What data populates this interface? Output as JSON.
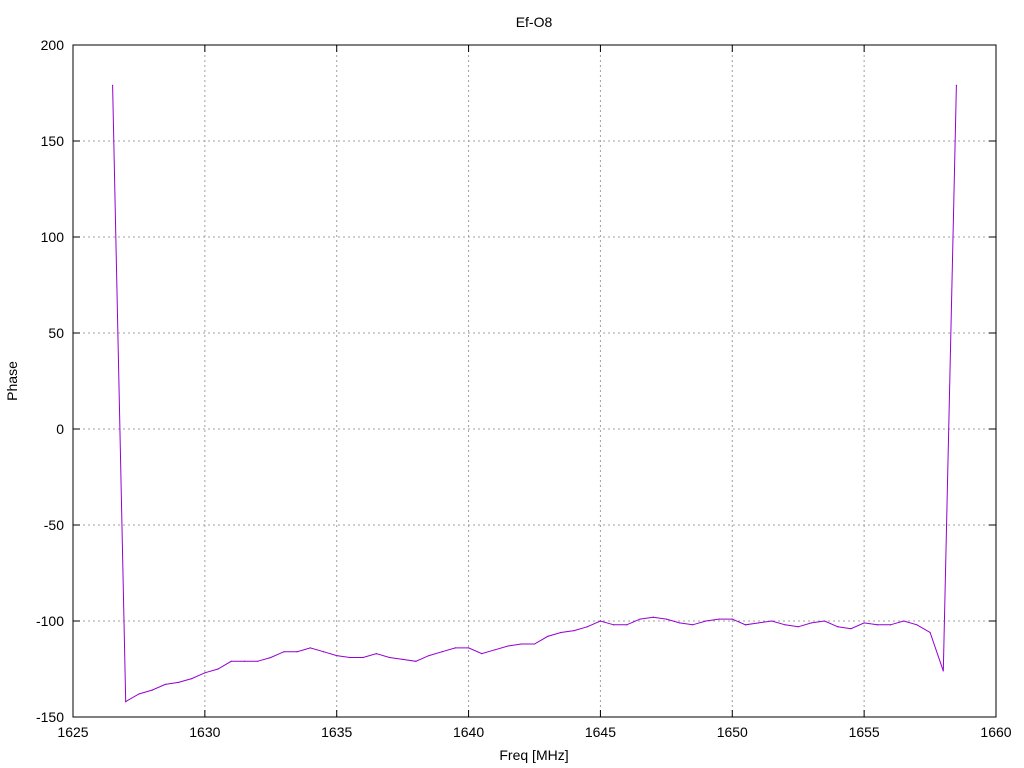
{
  "chart_data": {
    "type": "line",
    "title": "Ef-O8",
    "xlabel": "Freq [MHz]",
    "ylabel": "Phase",
    "xlim": [
      1625,
      1660
    ],
    "ylim": [
      -150,
      200
    ],
    "xticks": [
      1625,
      1630,
      1635,
      1640,
      1645,
      1650,
      1655,
      1660
    ],
    "yticks": [
      -150,
      -100,
      -50,
      0,
      50,
      100,
      150,
      200
    ],
    "grid": true,
    "series": [
      {
        "color": "#9400d3",
        "x": [
          1626.5,
          1627.0,
          1627.5,
          1628.0,
          1628.5,
          1629.0,
          1629.5,
          1630.0,
          1630.5,
          1631.0,
          1631.5,
          1632.0,
          1632.5,
          1633.0,
          1633.5,
          1634.0,
          1634.5,
          1635.0,
          1635.5,
          1636.0,
          1636.5,
          1637.0,
          1637.5,
          1638.0,
          1638.5,
          1639.0,
          1639.5,
          1640.0,
          1640.5,
          1641.0,
          1641.5,
          1642.0,
          1642.5,
          1643.0,
          1643.5,
          1644.0,
          1644.5,
          1645.0,
          1645.5,
          1646.0,
          1646.5,
          1647.0,
          1647.5,
          1648.0,
          1648.5,
          1649.0,
          1649.5,
          1650.0,
          1650.5,
          1651.0,
          1651.5,
          1652.0,
          1652.5,
          1653.0,
          1653.5,
          1654.0,
          1654.5,
          1655.0,
          1655.5,
          1656.0,
          1656.5,
          1657.0,
          1657.5,
          1658.0,
          1658.5
        ],
        "y": [
          179,
          -142,
          -138,
          -136,
          -133,
          -132,
          -130,
          -127,
          -125,
          -121,
          -121,
          -121,
          -119,
          -116,
          -116,
          -114,
          -116,
          -118,
          -119,
          -119,
          -117,
          -119,
          -120,
          -121,
          -118,
          -116,
          -114,
          -114,
          -117,
          -115,
          -113,
          -112,
          -112,
          -108,
          -106,
          -105,
          -103,
          -100,
          -102,
          -102,
          -99,
          -98,
          -99,
          -101,
          -102,
          -100,
          -99,
          -99,
          -102,
          -101,
          -100,
          -102,
          -103,
          -101,
          -100,
          -103,
          -104,
          -101,
          -102,
          -102,
          -100,
          -102,
          -106,
          -126,
          179
        ]
      }
    ]
  }
}
